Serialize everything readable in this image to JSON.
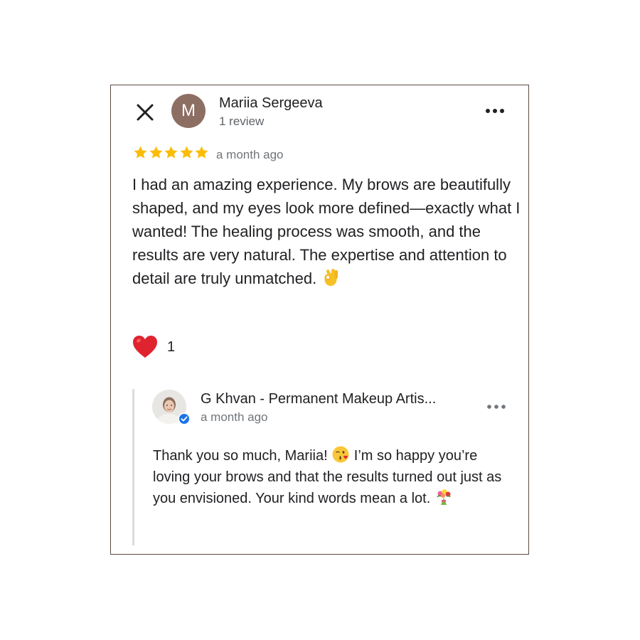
{
  "review": {
    "close_icon": "close-icon",
    "avatar_letter": "M",
    "avatar_color": "#8d6e63",
    "reviewer_name": "Mariia Sergeeva",
    "reviewer_meta": "1 review",
    "more_icon": "more-horizontal-icon",
    "rating": 5,
    "star_color": "#fbbc04",
    "time": "a month ago",
    "text": "I had an amazing experience. My brows are beautifully shaped, and my eyes look more defined—exactly what I wanted! The healing process was smooth, and the results are very natural. The expertise and attention to detail are truly unmatched.",
    "text_emoji": "ok-hand-emoji",
    "reaction_icon": "heart-icon",
    "reaction_count": "1"
  },
  "owner_reply": {
    "owner_name": "G Khvan - Permanent Makeup Artis...",
    "verified_icon": "verified-badge-icon",
    "time": "a month ago",
    "text_part1": "Thank you so much, Mariia!",
    "emoji1": "kissing-face-emoji",
    "text_part2": "I’m so happy you’re loving your brows and that the results turned out just as you envisioned. Your kind words mean a lot.",
    "emoji2": "bouquet-emoji"
  },
  "colors": {
    "border": "#5d4a44",
    "text_primary": "#202124",
    "text_secondary": "#70757a",
    "reply_bar": "#dadce0",
    "verified_blue": "#1a73e8",
    "heart_red": "#e0242f"
  }
}
